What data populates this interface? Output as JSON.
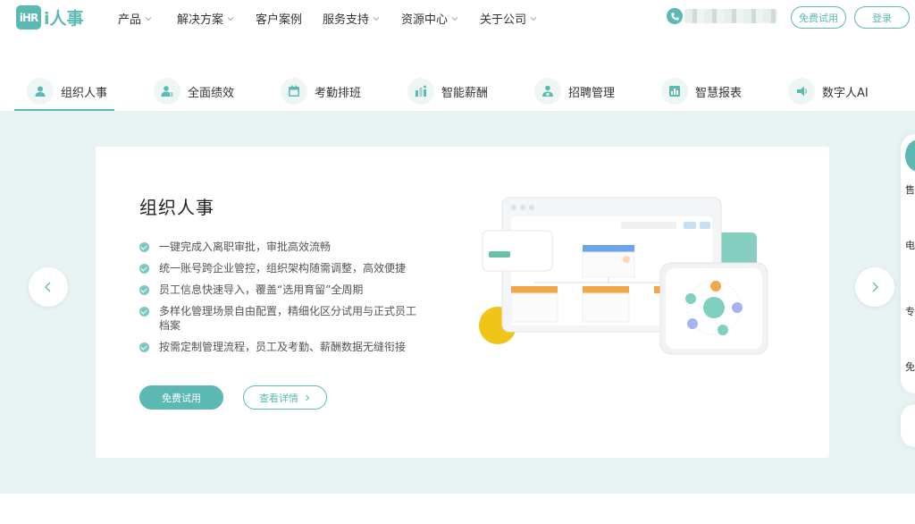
{
  "brand": {
    "badge": "iHR",
    "name": "i人事",
    "color": "#5cb8b2"
  },
  "nav": {
    "items": [
      {
        "label": "产品",
        "dropdown": true
      },
      {
        "label": "解决方案",
        "dropdown": true
      },
      {
        "label": "客户案例",
        "dropdown": false
      },
      {
        "label": "服务支持",
        "dropdown": true
      },
      {
        "label": "资源中心",
        "dropdown": true
      },
      {
        "label": "关于公司",
        "dropdown": true
      }
    ],
    "trial_label": "免费试用",
    "login_label": "登录"
  },
  "tabs": [
    {
      "label": "组织人事",
      "icon": "user-icon",
      "active": true
    },
    {
      "label": "全面绩效",
      "icon": "performance-icon",
      "active": false
    },
    {
      "label": "考勤排班",
      "icon": "calendar-icon",
      "active": false
    },
    {
      "label": "智能薪酬",
      "icon": "salary-icon",
      "active": false
    },
    {
      "label": "招聘管理",
      "icon": "recruit-icon",
      "active": false
    },
    {
      "label": "智慧报表",
      "icon": "report-icon",
      "active": false
    },
    {
      "label": "数字人AI",
      "icon": "ai-icon",
      "active": false
    }
  ],
  "hero": {
    "title": "组织人事",
    "features": [
      "一键完成入离职审批，审批高效流畅",
      "统一账号跨企业管控，组织架构随需调整，高效便捷",
      "员工信息快速导入，覆盖“选用育留”全周期",
      "多样化管理场景自由配置，精细化区分试用与正式员工档案",
      "按需定制管理流程，员工及考勤、薪酬数据无缝衔接"
    ],
    "trial_label": "免费试用",
    "detail_label": "查看详情"
  },
  "side_panel": {
    "items": [
      "售",
      "电",
      "专",
      "免"
    ]
  }
}
